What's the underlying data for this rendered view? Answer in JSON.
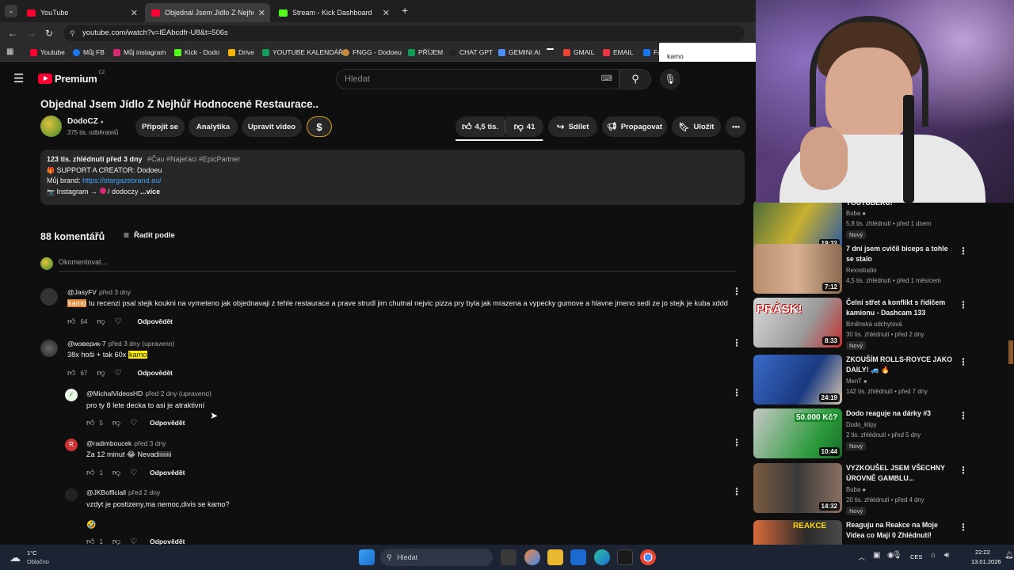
{
  "browser": {
    "tabs": [
      {
        "title": "YouTube",
        "active": false
      },
      {
        "title": "Objednal Jsem Jídlo Z Nejhůř H",
        "active": true
      },
      {
        "title": "Stream - Kick Dashboard",
        "active": false
      }
    ],
    "new_tab": "+",
    "url": "youtube.com/watch?v=lEAbcdfr-U8&t=506s",
    "bookmarks": [
      "Youtube",
      "Můj FB",
      "Můj instagram",
      "Kick - Dodo",
      "Drive",
      "YOUTUBE KALENDÁŘ",
      "FNGG - Dodoeu",
      "PŘÍJEM",
      "CHAT GPT",
      "GEMINI AI",
      "GMAIL",
      "EMAIL",
      "Fa"
    ],
    "find_text": "kamo"
  },
  "youtube": {
    "logo": "Premium",
    "logo_country": "CZ",
    "search_placeholder": "Hledat",
    "video_title": "Objednal Jsem Jídlo Z Nejhůř Hodnocené Restaurace..",
    "channel": {
      "name": "DodoCZ",
      "subs": "375 tis. odběratelů"
    },
    "buttons": {
      "join": "Připojit se",
      "analytics": "Analytika",
      "edit": "Upravit video",
      "likes": "4,5 tis.",
      "dislikes": "41",
      "share": "Sdílet",
      "promote": "Propagovat",
      "save": "Uložit"
    },
    "description": {
      "stats": "123 tis. zhlédnutí  před 3 dny",
      "tags": "#Čau #Najeťáci #EpicPartner",
      "line2": "SUPPORT A CREATOR: Dodoeu",
      "line3_label": "Můj brand: ",
      "line3_link": "https://stargazebrand.eu/",
      "line4": "Instagram → ",
      "line4_handle": "/ dodoczy",
      "more": "...více"
    },
    "comments_header": {
      "count": "88 komentářů",
      "sort": "Řadit podle",
      "add_placeholder": "Okomentovat..."
    },
    "comments": [
      {
        "author": "@JasyFV",
        "time": "před 3 dny",
        "hl": "kamo",
        "text": " tu recenzi psal stejk koukni na vymeteno jak objednavaji z tehle restaurace a prave strudl jim chutnal nejvic pizza pry byla jak mrazena a vypecky gumove a hlavne jmeno sedi ze jo stejk je kuba xddd",
        "likes": "64",
        "reply": "Odpovědět"
      },
      {
        "author": "@мэверик-7",
        "time": "před 3 dny (upraveno)",
        "text_pre": "38x hoši + tak 60x ",
        "hl": "kamo",
        "likes": "67",
        "reply": "Odpovědět"
      },
      {
        "author": "@MichalVideosHD",
        "time": "před 2 dny (upraveno)",
        "text": "pro ty 8 lete decka to asi je atraktivní",
        "likes": "5",
        "reply": "Odpovědět"
      },
      {
        "author": "@radimboucek",
        "time": "před 3 dny",
        "text": "Za 12 minut 😂 Nevadiiiiiiii",
        "likes": "1",
        "reply": "Odpovědět",
        "avatar_letter": "R"
      },
      {
        "author": "@JKBofficiall",
        "time": "před 2 dny",
        "text": "vzdyt je postizeny,ma nemoc,divis se kamo?",
        "extra": "🤣",
        "likes": "1",
        "reply": "Odpovědět"
      }
    ]
  },
  "sidebar": [
    {
      "title": "YOUTUBERŮ!",
      "channel": "Buba",
      "meta": "5,8 tis. zhlédnutí • před 1 dnem",
      "badge": "Nový",
      "duration": "19:32"
    },
    {
      "title": "7 dní jsem cvičil biceps a tohle se stalo",
      "channel": "Rexxstudio",
      "meta": "4,5 tis. zhlédnutí • před 1 měsícem",
      "duration": "7:12"
    },
    {
      "title": "Čelní střet a konflikt s řidičem kamionu - Dashcam 133",
      "channel": "Brněnská odchytová",
      "meta": "30 tis. zhlédnutí • před 2 dny",
      "badge": "Nový",
      "duration": "8:33",
      "thumb_text": "PRÁSK!"
    },
    {
      "title": "ZKOUŠÍM ROLLS-ROYCE JAKO DAILY! 🚙 🔥",
      "channel": "MenT",
      "meta": "142 tis. zhlédnutí • před 7 dny",
      "duration": "24:19"
    },
    {
      "title": "Dodo reaguje na dárky #3",
      "channel": "Dodo_klipy",
      "meta": "2 tis. zhlédnutí • před 5 dny",
      "badge": "Nový",
      "duration": "10:44",
      "thumb_text": "50.000 Kč?"
    },
    {
      "title": "VYZKOUŠEL JSEM VŠECHNY ÚROVNĚ GAMBLU...",
      "channel": "Buba",
      "meta": "20 tis. zhlédnutí • před 4 dny",
      "badge": "Nový",
      "duration": "14:32"
    },
    {
      "title": "Reaguju na Reakce na Moje Videa co Mají 0 Zhlédnutí!",
      "channel": "",
      "meta": "",
      "duration": "",
      "thumb_text": "REAKCE"
    }
  ],
  "taskbar": {
    "weather_temp": "1°C",
    "weather_desc": "Oblačno",
    "search": "Hledat",
    "lang": "CES",
    "time": "22:22",
    "date": "13.01.2026"
  },
  "colors": {
    "accent_red": "#ff0033",
    "highlight_orange": "#e28b3a",
    "highlight_yellow": "#ffee00",
    "link_blue": "#3ea6ff"
  }
}
